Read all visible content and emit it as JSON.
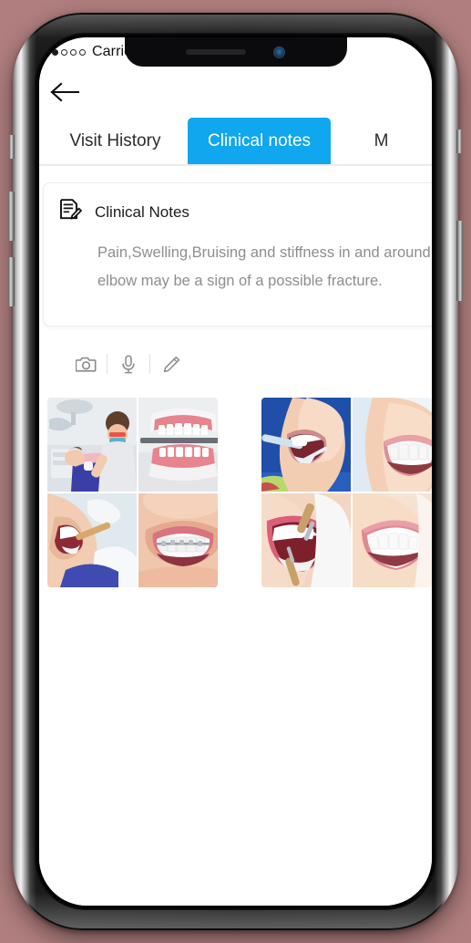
{
  "background_color": "#b07e7e",
  "device": {
    "name": "smartphone-mockup",
    "notch": {
      "speaker": "speaker-grille",
      "camera": "front-camera"
    }
  },
  "status_bar": {
    "signal_icon": "signal-dots-icon",
    "carrier": "Carrier"
  },
  "nav": {
    "back_icon": "back-arrow-icon"
  },
  "tabs": [
    {
      "label": "Visit History",
      "active": false
    },
    {
      "label": "Clinical notes",
      "active": true
    },
    {
      "label": "M",
      "active": false
    }
  ],
  "accent_color": "#10a7ef",
  "card": {
    "icon": "note-edit-icon",
    "title": "Clinical Notes",
    "body_line_1": "Pain,Swelling,Bruising and stiffness in and around t",
    "body_line_2": "elbow may be a sign of a possible fracture.",
    "body_color": "#8e8e8e"
  },
  "actions": [
    {
      "icon": "camera-icon",
      "label": "Camera"
    },
    {
      "icon": "microphone-icon",
      "label": "Voice note"
    },
    {
      "icon": "pencil-icon",
      "label": "Draw"
    }
  ],
  "attachments": {
    "grid_left": [
      {
        "caption": "dentist-treating-patient-in-chair"
      },
      {
        "caption": "dental-model-with-instrument"
      },
      {
        "caption": "patient-open-mouth-examination"
      },
      {
        "caption": "smile-with-braces"
      }
    ],
    "grid_right": [
      {
        "caption": "teeth-cleaning-with-tool"
      },
      {
        "caption": "woman-smiling-white-teeth"
      },
      {
        "caption": "dental-scaling-close-up"
      },
      {
        "caption": "close-up-bright-smile"
      }
    ]
  }
}
